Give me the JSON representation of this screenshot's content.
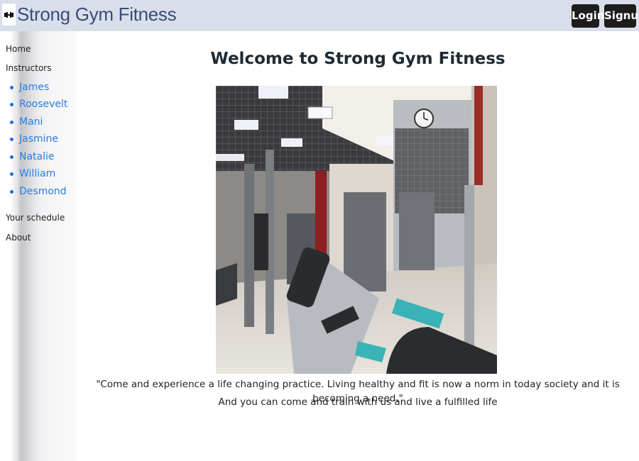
{
  "header": {
    "brand": "Strong Gym Fitness",
    "logo_icon": "dumbbell-icon",
    "login_label": "Login",
    "signup_label": "Signup"
  },
  "sidebar": {
    "home": "Home",
    "instructors_label": "Instructors",
    "instructors": [
      "James",
      "Roosevelt",
      "Mani",
      "Jasmine",
      "Natalie",
      "William",
      "Desmond"
    ],
    "schedule": "Your schedule",
    "about": "About"
  },
  "main": {
    "title": "Welcome to Strong Gym Fitness",
    "quote_line1": "\"Come and experience a life changing practice. Living healthy and fit is now a norm in today society and it is becoming a need.\"",
    "quote_line2": "And you can come and train with us and live a fulfilled life"
  },
  "colors": {
    "header_bg": "#d9dfea",
    "brand_text": "#3b4a7a",
    "button_bg": "#1f1c1c",
    "link_blue": "#2a7de1"
  }
}
